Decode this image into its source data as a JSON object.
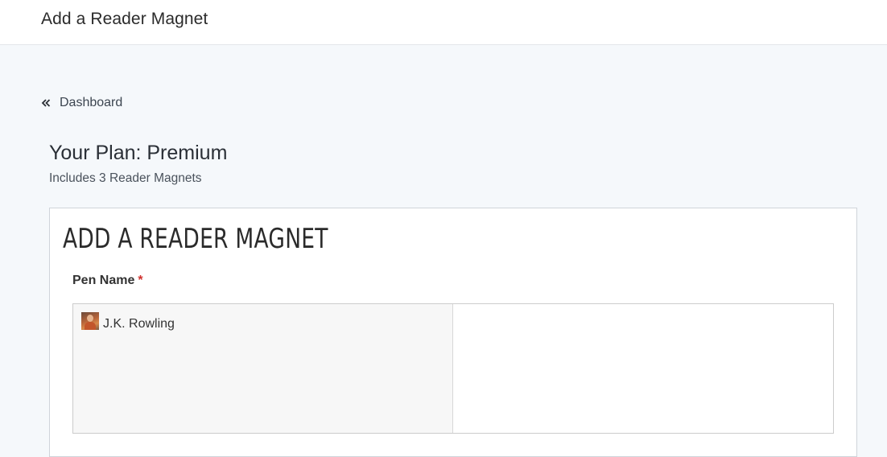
{
  "header": {
    "title": "Add a Reader Magnet"
  },
  "breadcrumb": {
    "icon": "double-chevron-left-icon",
    "label": "Dashboard"
  },
  "plan": {
    "title": "Your Plan: Premium",
    "subtitle": "Includes 3 Reader Magnets"
  },
  "form": {
    "heading": "ADD A READER MAGNET",
    "pen_name": {
      "label": "Pen Name",
      "required_marker": "*",
      "options": [
        {
          "name": "J.K. Rowling",
          "icon": "author-avatar"
        }
      ]
    }
  },
  "colors": {
    "page_background": "#f5f8fb",
    "required": "#d0312d",
    "border": "#cfd4da"
  }
}
